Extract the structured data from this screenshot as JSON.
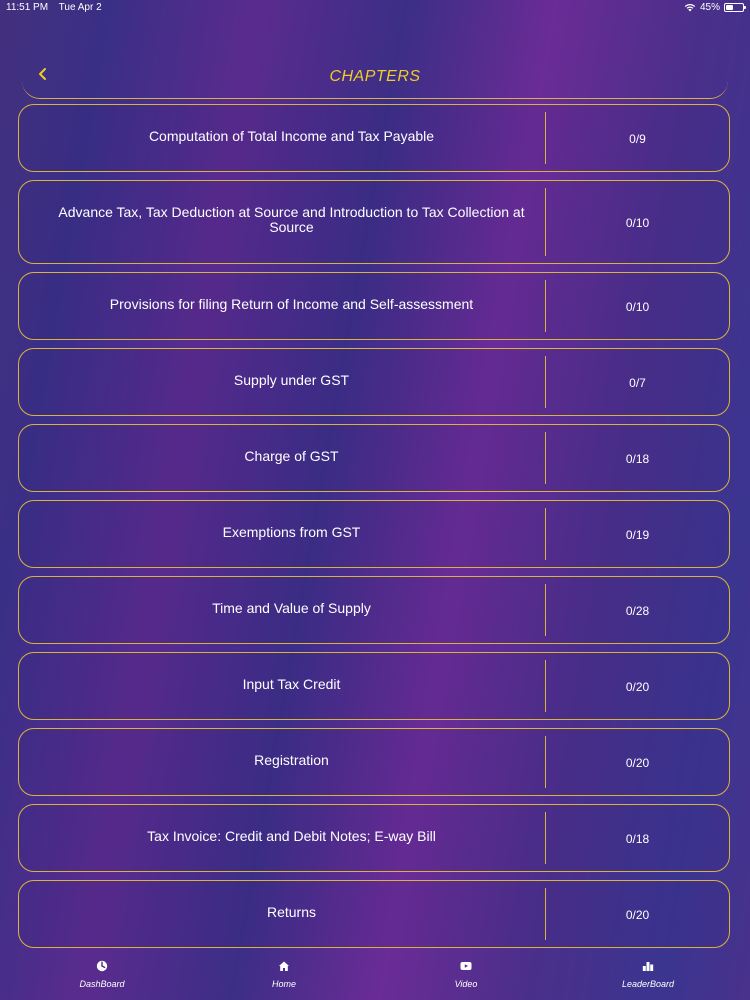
{
  "status_bar": {
    "time": "11:51 PM",
    "date": "Tue Apr 2",
    "battery_percent": "45%",
    "battery_level": 0.45
  },
  "header": {
    "back_icon": "chevron-left-icon",
    "title": "CHAPTERS",
    "accent_color": "#f0cc28"
  },
  "chapters": [
    {
      "title": "Computation of Total Income and Tax Payable",
      "count": "0/9"
    },
    {
      "title": "Advance Tax, Tax Deduction at Source and Introduction to Tax Collection at Source",
      "count": "0/10"
    },
    {
      "title": "Provisions for filing Return of Income and Self-assessment",
      "count": "0/10"
    },
    {
      "title": "Supply under GST",
      "count": "0/7"
    },
    {
      "title": "Charge of GST",
      "count": "0/18"
    },
    {
      "title": "Exemptions from GST",
      "count": "0/19"
    },
    {
      "title": "Time and Value of Supply",
      "count": "0/28"
    },
    {
      "title": "Input Tax Credit",
      "count": "0/20"
    },
    {
      "title": "Registration",
      "count": "0/20"
    },
    {
      "title": "Tax Invoice: Credit and Debit Notes; E-way Bill",
      "count": "0/18"
    },
    {
      "title": "Returns",
      "count": "0/20"
    }
  ],
  "tabs": [
    {
      "label": "DashBoard",
      "icon": "dashboard-icon"
    },
    {
      "label": "Home",
      "icon": "home-icon"
    },
    {
      "label": "Video",
      "icon": "video-icon"
    },
    {
      "label": "LeaderBoard",
      "icon": "leaderboard-icon"
    }
  ],
  "colors": {
    "border": "#d8b340",
    "text": "#ffffff",
    "title": "#f0cc28"
  }
}
